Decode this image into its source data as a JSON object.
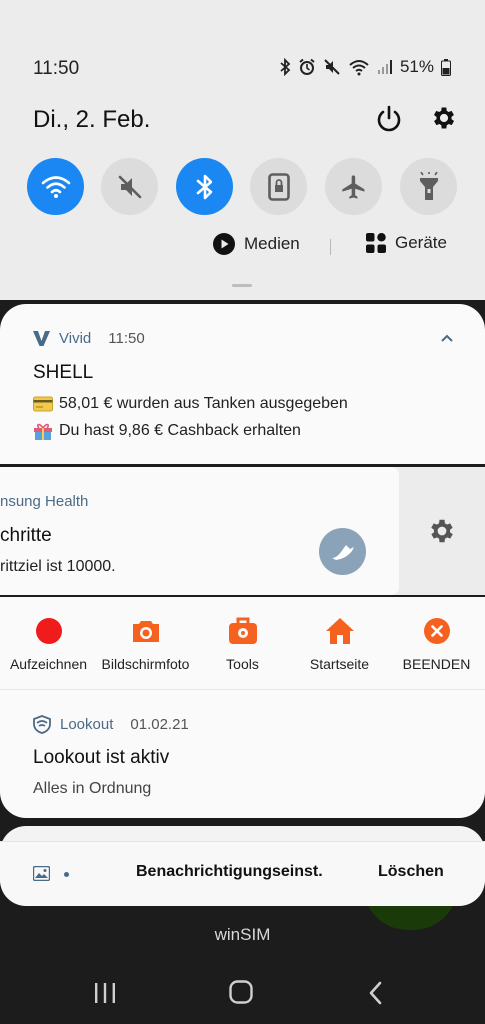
{
  "status_bar": {
    "time": "11:50",
    "battery": "51%",
    "icons": [
      "bluetooth-icon",
      "alarm-icon",
      "mute-icon",
      "wifi-icon",
      "signal-icon",
      "battery-icon"
    ]
  },
  "quick_panel": {
    "date": "Di., 2. Feb.",
    "toggles": [
      {
        "name": "wifi",
        "on": true
      },
      {
        "name": "sound-mute",
        "on": false
      },
      {
        "name": "bluetooth",
        "on": true
      },
      {
        "name": "screen-lock",
        "on": false
      },
      {
        "name": "airplane-mode",
        "on": false
      },
      {
        "name": "flashlight",
        "on": false
      }
    ],
    "media_label": "Medien",
    "devices_label": "Geräte"
  },
  "notifications": {
    "vivid": {
      "app": "Vivid",
      "time": "11:50",
      "title": "SHELL",
      "line1": "58,01 € wurden aus Tanken ausgegeben",
      "line2": "Du hast 9,86 € Cashback erhalten"
    },
    "health": {
      "app": "nsung Health",
      "title": "chritte",
      "text": "rittziel ist 10000."
    },
    "recorder_actions": [
      {
        "label": "Aufzeichnen",
        "icon": "record-icon"
      },
      {
        "label": "Bildschirmfoto",
        "icon": "camera-icon"
      },
      {
        "label": "Tools",
        "icon": "toolbox-icon"
      },
      {
        "label": "Startseite",
        "icon": "home-icon"
      },
      {
        "label": "BEENDEN",
        "icon": "close-icon"
      }
    ],
    "lookout": {
      "app": "Lookout",
      "date": "01.02.21",
      "title": "Lookout ist aktiv",
      "text": "Alles in Ordnung"
    }
  },
  "bottom_bar": {
    "settings_label": "Benachrichtigungseinst.",
    "clear_label": "Löschen"
  },
  "carrier": "winSIM",
  "colors": {
    "accent": "#1a87f2",
    "orange": "#f5621f",
    "record_red": "#f01b1b",
    "app_name": "#4a6b87"
  }
}
